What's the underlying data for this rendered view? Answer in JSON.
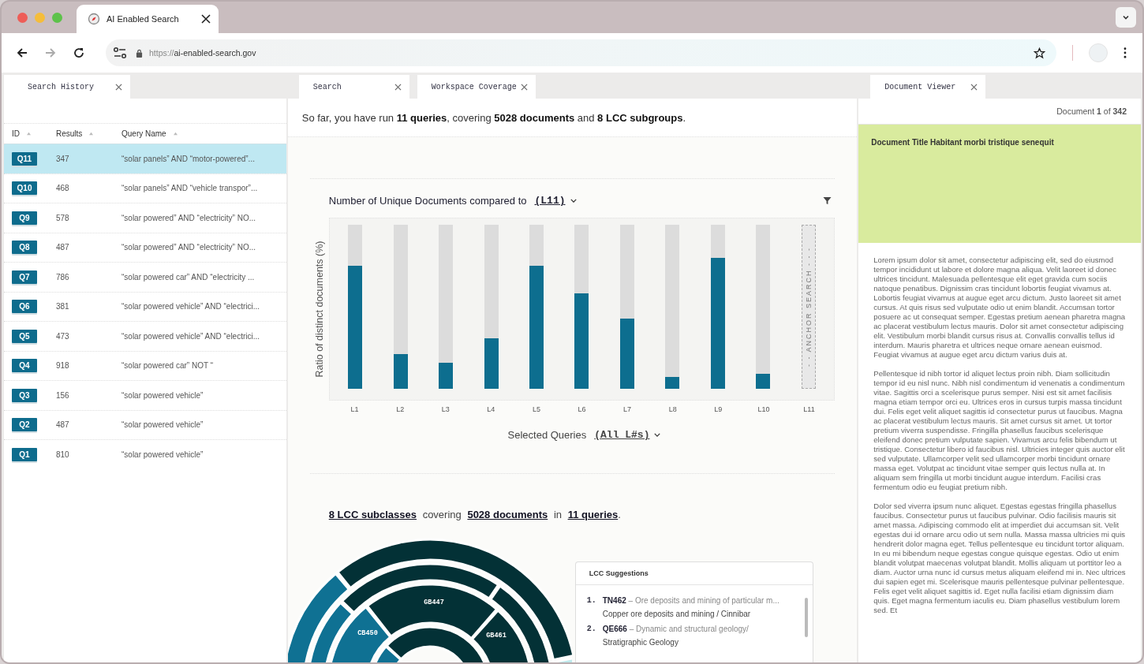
{
  "browser": {
    "tab_title": "AI Enabled Search",
    "url_scheme": "https://",
    "url_host": "ai-enabled-search.gov"
  },
  "search_history": {
    "tab": "Search History",
    "columns": [
      "ID",
      "Results",
      "Query Name"
    ],
    "rows": [
      {
        "id": "Q11",
        "results": "347",
        "query": "“solar panels” AND “motor-powered”...",
        "selected": true
      },
      {
        "id": "Q10",
        "results": "468",
        "query": "“solar panels” AND “vehicle transpor”...",
        "selected": false
      },
      {
        "id": "Q9",
        "results": "578",
        "query": "“solar powered” AND “electricity” NO...",
        "selected": false
      },
      {
        "id": "Q8",
        "results": "487",
        "query": "“solar powered” AND “electricity” NO...",
        "selected": false
      },
      {
        "id": "Q7",
        "results": "786",
        "query": "“solar powered car” AND “electricity ...",
        "selected": false
      },
      {
        "id": "Q6",
        "results": "381",
        "query": "“solar powered vehicle” AND “electrici...",
        "selected": false
      },
      {
        "id": "Q5",
        "results": "473",
        "query": "“solar powered vehicle” AND “electrici...",
        "selected": false
      },
      {
        "id": "Q4",
        "results": "918",
        "query": "“solar powered car” NOT “",
        "selected": false
      },
      {
        "id": "Q3",
        "results": "156",
        "query": "“solar powered vehicle”",
        "selected": false
      },
      {
        "id": "Q2",
        "results": "487",
        "query": "“solar powered vehicle”",
        "selected": false
      },
      {
        "id": "Q1",
        "results": "810",
        "query": "“solar powered vehicle”",
        "selected": false
      }
    ]
  },
  "center_tabs": [
    "Search",
    "Workspace Coverage"
  ],
  "summary": "So far, you have run **11 queries**, covering **5028 documents** and **8 LCC subgroups**.",
  "chart": {
    "title": "Number of Unique Documents compared to",
    "compare": "(L11)",
    "ylabel": "Ratio of distinct documents (%)",
    "xlabel": "Selected Queries",
    "selection": "(All L#s)",
    "bars": [
      {
        "label": "L1",
        "kind": "bar",
        "level": 0.75
      },
      {
        "label": "L2",
        "kind": "bar",
        "level": 0.21
      },
      {
        "label": "L3",
        "kind": "bar",
        "level": 0.16
      },
      {
        "label": "L4",
        "kind": "bar",
        "level": 0.31
      },
      {
        "label": "L5",
        "kind": "bar",
        "level": 0.75
      },
      {
        "label": "L6",
        "kind": "bar",
        "level": 0.58
      },
      {
        "label": "L7",
        "kind": "bar",
        "level": 0.43
      },
      {
        "label": "L8",
        "kind": "bar",
        "level": 0.07
      },
      {
        "label": "L9",
        "kind": "bar",
        "level": 0.8
      },
      {
        "label": "L10",
        "kind": "bar",
        "level": 0.09
      },
      {
        "label": "L11",
        "kind": "anchor",
        "anchor_text": "- - ANCHOR SEARCH - - -"
      }
    ]
  },
  "coverage": {
    "subclasses": "8 LCC subclasses",
    "word1": "covering",
    "documents": "5028 documents",
    "word2": "in",
    "queries": "11 queries",
    "end": "."
  },
  "sunburst_labels": [
    "GB447",
    "CB450",
    "GB461"
  ],
  "suggestions": {
    "title": "LCC Suggestions",
    "items": [
      {
        "number": "1.",
        "code": "TN462",
        "description": "– Ore deposits and mining of particular m...",
        "subtitle": "Copper ore deposits and mining / Cinnibar"
      },
      {
        "number": "2.",
        "code": "QE666",
        "description": "– Dynamic and structural geology/",
        "subtitle": "Stratigraphic Geology"
      }
    ]
  },
  "viewer": {
    "tab": "Document Viewer",
    "counter": "Document **1** of **342**",
    "title": "Document Title Habitant morbi tristique senequit",
    "paragraphs": [
      "Lorem ipsum dolor sit amet, consectetur adipiscing elit, sed do eiusmod tempor incididunt ut labore et dolore magna aliqua. Velit laoreet id donec ultrices tincidunt. Malesuada pellentesque elit eget gravida cum sociis natoque penatibus. Dignissim cras tincidunt lobortis feugiat vivamus at. Lobortis feugiat vivamus at augue eget arcu dictum. Justo laoreet sit amet cursus. At quis risus sed vulputate odio ut enim blandit. Accumsan tortor posuere ac ut consequat semper. Egestas pretium aenean pharetra magna ac placerat vestibulum lectus mauris. Dolor sit amet consectetur adipiscing elit. Vestibulum morbi blandit cursus risus at. Convallis convallis tellus id interdum. Mauris pharetra et ultrices neque ornare aenean euismod. Feugiat vivamus at augue eget arcu dictum varius duis at.",
      "Pellentesque id nibh tortor id aliquet lectus proin nibh. Diam sollicitudin tempor id eu nisl nunc. Nibh nisl condimentum id venenatis a condimentum vitae. Sagittis orci a scelerisque purus semper. Nisi est sit amet facilisis magna etiam tempor orci eu. Ultrices eros in cursus turpis massa tincidunt dui. Felis eget velit aliquet sagittis id consectetur purus ut faucibus. Magna ac placerat vestibulum lectus mauris. Sit amet cursus sit amet. Ut tortor pretium viverra suspendisse. Fringilla phasellus faucibus scelerisque eleifend donec pretium vulputate sapien. Vivamus arcu felis bibendum ut tristique. Consectetur libero id faucibus nisl. Ultricies integer quis auctor elit sed vulputate. Ullamcorper velit sed ullamcorper morbi tincidunt ornare massa eget. Volutpat ac tincidunt vitae semper quis lectus nulla at. In aliquam sem fringilla ut morbi tincidunt augue interdum. Facilisi cras fermentum odio eu feugiat pretium nibh.",
      "Dolor sed viverra ipsum nunc aliquet. Egestas egestas fringilla phasellus faucibus. Consectetur purus ut faucibus pulvinar. Odio facilisis mauris sit amet massa. Adipiscing commodo elit at imperdiet dui accumsan sit. Velit egestas dui id ornare arcu odio ut sem nulla. Massa massa ultricies mi quis hendrerit dolor magna eget. Tellus pellentesque eu tincidunt tortor aliquam. In eu mi bibendum neque egestas congue quisque egestas. Odio ut enim blandit volutpat maecenas volutpat blandit. Mollis aliquam ut porttitor leo a diam. Auctor urna nunc id cursus metus aliquam eleifend mi in. Nec ultrices dui sapien eget mi. Scelerisque mauris pellentesque pulvinar pellentesque. Felis eget velit aliquet sagittis id. Eget nulla facilisi etiam dignissim diam quis. Eget magna fermentum iaculis eu. Diam phasellus vestibulum lorem sed. Et"
    ]
  }
}
